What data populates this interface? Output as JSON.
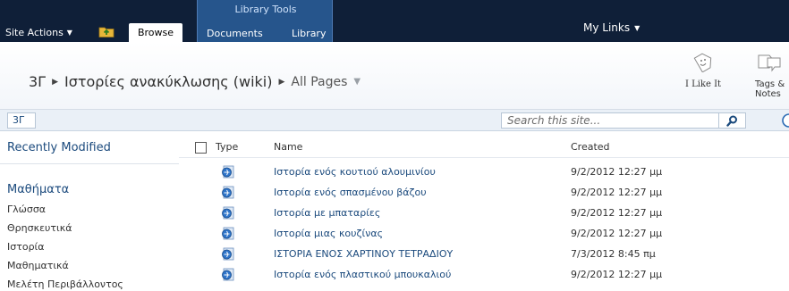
{
  "ribbon": {
    "site_actions": "Site Actions",
    "browse": "Browse",
    "library_tools": "Library Tools",
    "documents": "Documents",
    "library": "Library",
    "my_links": "My Links"
  },
  "breadcrumb": {
    "site": "3Γ",
    "library": "Ιστορίες ανακύκλωσης (wiki)",
    "view": "All Pages"
  },
  "ribbon_right": {
    "like_it": "I Like It",
    "tags_notes_line1": "Tags &",
    "tags_notes_line2": "Notes"
  },
  "top_bar": {
    "home_tab": "3Γ",
    "search_placeholder": "Search this site..."
  },
  "left_nav": {
    "recently_modified": "Recently Modified",
    "heading": "Μαθήματα",
    "items": [
      "Γλώσσα",
      "Θρησκευτικά",
      "Ιστορία",
      "Μαθηματικά",
      "Μελέτη Περιβάλλοντος"
    ]
  },
  "list": {
    "columns": {
      "type": "Type",
      "name": "Name",
      "created": "Created"
    },
    "rows": [
      {
        "name": "Ιστορία ενός κουτιού αλουμινίου",
        "created": "9/2/2012 12:27 μμ"
      },
      {
        "name": "Ιστορία ενός σπασμένου βάζου",
        "created": "9/2/2012 12:27 μμ"
      },
      {
        "name": "Ιστορία με μπαταρίες",
        "created": "9/2/2012 12:27 μμ"
      },
      {
        "name": "Ιστορία μιας κουζίνας",
        "created": "9/2/2012 12:27 μμ"
      },
      {
        "name": "ΙΣΤΟΡΙΑ ΕΝΟΣ ΧΑΡΤΙΝΟΥ ΤΕΤΡΑΔΙΟΥ",
        "created": "7/3/2012 8:45 πμ"
      },
      {
        "name": "Ιστορία ενός πλαστικού μπουκαλιού",
        "created": "9/2/2012 12:27 μμ"
      }
    ]
  },
  "colors": {
    "ribbon_dark": "#0f1f38",
    "library_tools": "#26558c",
    "link_blue": "#1b4a7d"
  }
}
